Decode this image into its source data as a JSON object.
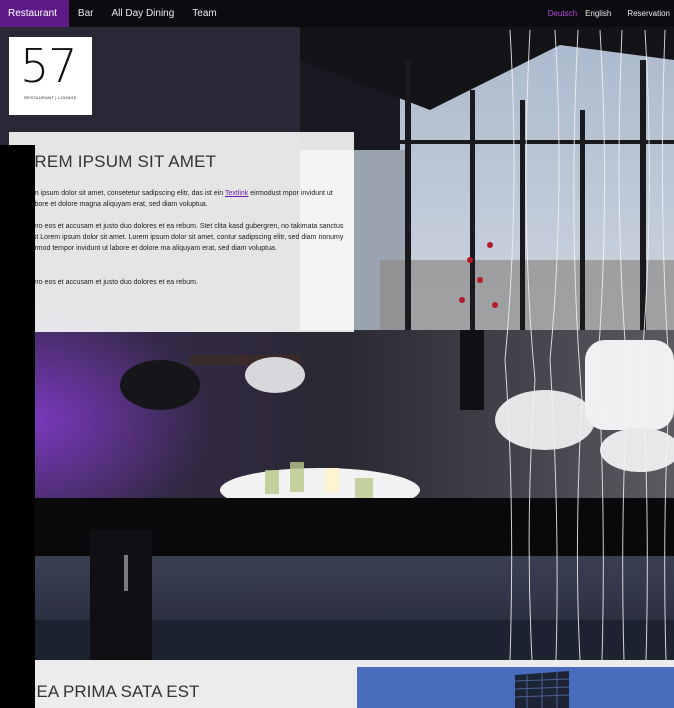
{
  "nav": {
    "items": [
      {
        "label": "Restaurant",
        "active": true
      },
      {
        "label": "Bar",
        "active": false
      },
      {
        "label": "All Day Dining",
        "active": false
      },
      {
        "label": "Team",
        "active": false
      }
    ],
    "languages": [
      {
        "label": "Deutsch",
        "active": true
      },
      {
        "label": "English",
        "active": false
      }
    ],
    "reservation": "Reservation"
  },
  "logo": {
    "number": "57",
    "subtitle": "RESTAURANT | LOUNGE"
  },
  "content": {
    "heading": "OREM IPSUM SIT AMET",
    "paragraph1_before": "em ipsum dolor sit amet, consetetur sadipscing elitr, das ist ein ",
    "paragraph1_link": "Textlink",
    "paragraph1_after": " eirmod­ust mpor invidunt ut labore et dolore magna aliquyam erat, sed diam voluptua.",
    "paragraph2": "vero eos et accusam et justo duo dolores et ea rebum. Stet clita kasd gubergren, no takimata sanctus est Lorem ipsum dolor sit amet. Lorem ipsum dolor sit amet, con­tur sadipscing elitr, sed diam nonumy eirmod tempor invidunt ut labore et dolore ma aliquyam erat, sed diam voluptua.",
    "paragraph3": "vero eos et accusam et justo duo dolores et ea rebum."
  },
  "bottom": {
    "heading": "UREA PRIMA SATA EST"
  },
  "colors": {
    "accent": "#5e1a86",
    "link": "#6a1fa8",
    "active_language": "#b34ad9"
  }
}
